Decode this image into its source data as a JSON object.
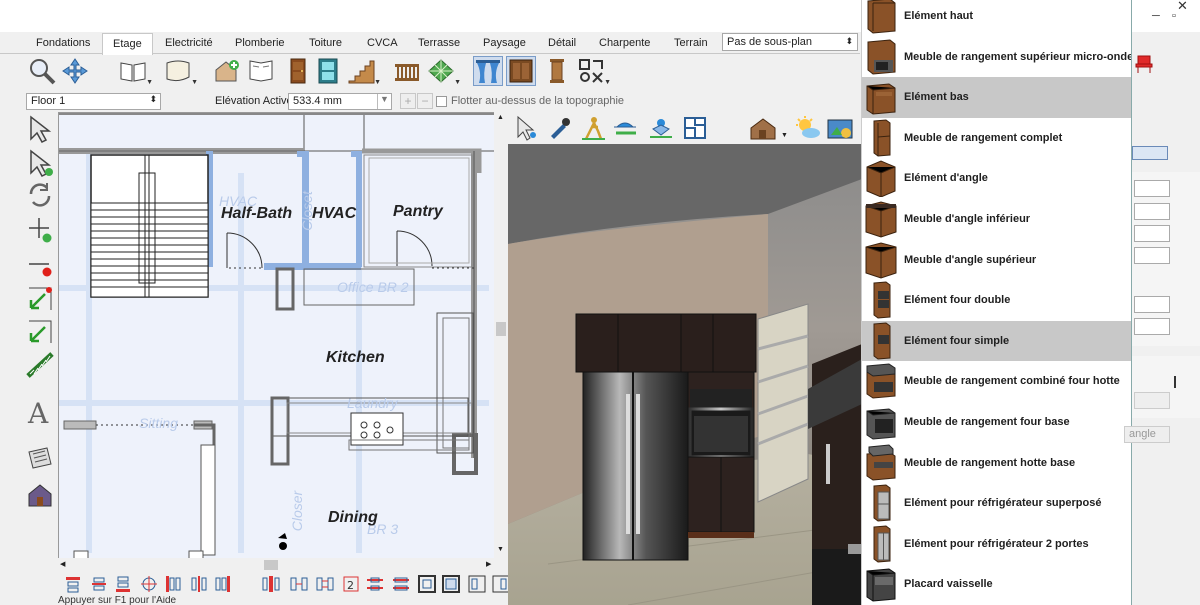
{
  "window": {
    "minimize": "─",
    "restore": "▫",
    "close": "✕"
  },
  "tabs": [
    "Fondations",
    "Etage",
    "Electricité",
    "Plomberie",
    "Toiture",
    "CVCA",
    "Terrasse",
    "Paysage",
    "Détail",
    "Charpente",
    "Terrain"
  ],
  "active_tab": "Etage",
  "plan_select": {
    "value": "Pas de sous-plan"
  },
  "toolbar_icons": [
    "zoom-icon",
    "pan-icon",
    "book-open-icon",
    "scroll-icon",
    "house-add-icon",
    "layout-icon",
    "door-icon",
    "window-icon",
    "stairs-icon",
    "railing-icon",
    "hatch-icon",
    "curtain-icon",
    "cabinet-icon",
    "column-icon",
    "shapes-icon"
  ],
  "options": {
    "floor_value": "Floor 1",
    "elevation_label": "Elévation Active:",
    "elevation_value": "533.4 mm",
    "float_label": "Flotter au-dessus de la topographie"
  },
  "plan_labels": {
    "half_bath": "Half-Bath",
    "hvac": "HVAC",
    "pantry": "Pantry",
    "kitchen": "Kitchen",
    "dining": "Dining",
    "ghost_hvac": "HVAC",
    "ghost_closet": "Closet",
    "ghost_office": "Office BR 2",
    "ghost_laundry": "Laundry",
    "ghost_sitting": "Sitting",
    "ghost_closer": "Closer",
    "ghost_br3": "BR 3"
  },
  "status": {
    "text": "Appuyer sur F1 pour l'Aide"
  },
  "catalog": [
    {
      "label": "Elément haut",
      "icon": "upper-cabinet-icon",
      "highlighted": false
    },
    {
      "label": "Meuble de rangement supérieur micro-onde",
      "icon": "microwave-cabinet-icon",
      "highlighted": false
    },
    {
      "label": "Elément bas",
      "icon": "base-cabinet-icon",
      "highlighted": true
    },
    {
      "label": "Meuble de rangement complet",
      "icon": "full-cabinet-icon",
      "highlighted": false
    },
    {
      "label": "Elément d'angle",
      "icon": "corner-cabinet-icon",
      "highlighted": false
    },
    {
      "label": "Meuble d'angle inférieur",
      "icon": "lower-corner-cabinet-icon",
      "highlighted": false
    },
    {
      "label": "Meuble d'angle supérieur",
      "icon": "upper-corner-cabinet-icon",
      "highlighted": false
    },
    {
      "label": "Elément four double",
      "icon": "double-oven-icon",
      "highlighted": false
    },
    {
      "label": "Elément four simple",
      "icon": "single-oven-icon",
      "highlighted": true
    },
    {
      "label": "Meuble de rangement combiné four hotte",
      "icon": "oven-hood-icon",
      "highlighted": false
    },
    {
      "label": "Meuble de rangement four base",
      "icon": "oven-base-icon",
      "highlighted": false
    },
    {
      "label": "Meuble de rangement hotte base",
      "icon": "hood-base-icon",
      "highlighted": false
    },
    {
      "label": "Elément pour réfrigérateur superposé",
      "icon": "stacked-fridge-icon",
      "highlighted": false
    },
    {
      "label": "Elément pour réfrigérateur 2 portes",
      "icon": "two-door-fridge-icon",
      "highlighted": false
    },
    {
      "label": "Placard vaisselle",
      "icon": "hutch-icon",
      "highlighted": false
    }
  ],
  "right_panel": {
    "button_fragment": "angle"
  },
  "colors": {
    "wall_blue": "#8eb0e0",
    "plan_bg": "#eef2fb",
    "highlight": "#c8c8c8",
    "cabinet_brown": "#7a4a22"
  }
}
